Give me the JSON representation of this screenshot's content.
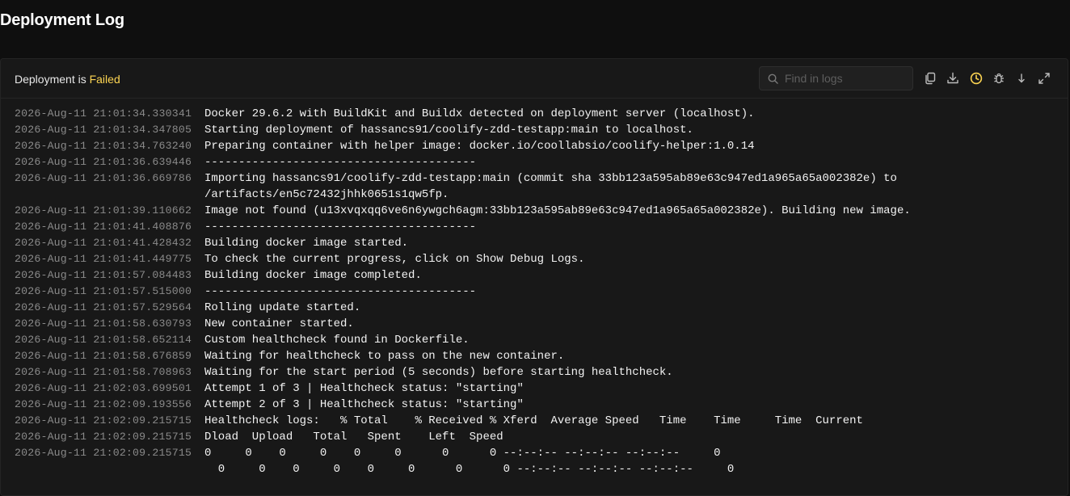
{
  "page": {
    "title": "Deployment Log"
  },
  "header": {
    "status_prefix": "Deployment is",
    "status_value": "Failed",
    "search_placeholder": "Find in logs",
    "toolbar": [
      {
        "name": "copy-logs",
        "icon": "copy-icon"
      },
      {
        "name": "download-logs",
        "icon": "download-icon"
      },
      {
        "name": "toggle-timestamps",
        "icon": "clock-icon",
        "active": true
      },
      {
        "name": "toggle-debug-logs",
        "icon": "bug-icon"
      },
      {
        "name": "scroll-to-bottom",
        "icon": "arrow-down-icon"
      },
      {
        "name": "fullscreen",
        "icon": "expand-icon"
      }
    ]
  },
  "colors": {
    "accent_failed": "#fcd452",
    "active_icon": "#fcd452",
    "timestamp": "#8a8a8a",
    "message": "#f2f2f2"
  },
  "logs": [
    {
      "ts": "2026-Aug-11 21:01:34.330341",
      "msg": "Docker 29.6.2 with BuildKit and Buildx detected on deployment server (localhost)."
    },
    {
      "ts": "2026-Aug-11 21:01:34.347805",
      "msg": "Starting deployment of hassancs91/coolify-zdd-testapp:main to localhost."
    },
    {
      "ts": "2026-Aug-11 21:01:34.763240",
      "msg": "Preparing container with helper image: docker.io/coollabsio/coolify-helper:1.0.14"
    },
    {
      "ts": "2026-Aug-11 21:01:36.639446",
      "msg": "----------------------------------------"
    },
    {
      "ts": "2026-Aug-11 21:01:36.669786",
      "msg": "Importing hassancs91/coolify-zdd-testapp:main (commit sha 33bb123a595ab89e63c947ed1a965a65a002382e) to"
    },
    {
      "ts": "",
      "msg": "/artifacts/en5c72432jhhk0651s1qw5fp."
    },
    {
      "ts": "2026-Aug-11 21:01:39.110662",
      "msg": "Image not found (u13xvqxqq6ve6n6ywgch6agm:33bb123a595ab89e63c947ed1a965a65a002382e). Building new image."
    },
    {
      "ts": "2026-Aug-11 21:01:41.408876",
      "msg": "----------------------------------------"
    },
    {
      "ts": "2026-Aug-11 21:01:41.428432",
      "msg": "Building docker image started."
    },
    {
      "ts": "2026-Aug-11 21:01:41.449775",
      "msg": "To check the current progress, click on Show Debug Logs."
    },
    {
      "ts": "2026-Aug-11 21:01:57.084483",
      "msg": "Building docker image completed."
    },
    {
      "ts": "2026-Aug-11 21:01:57.515000",
      "msg": "----------------------------------------"
    },
    {
      "ts": "2026-Aug-11 21:01:57.529564",
      "msg": "Rolling update started."
    },
    {
      "ts": "2026-Aug-11 21:01:58.630793",
      "msg": "New container started."
    },
    {
      "ts": "2026-Aug-11 21:01:58.652114",
      "msg": "Custom healthcheck found in Dockerfile."
    },
    {
      "ts": "2026-Aug-11 21:01:58.676859",
      "msg": "Waiting for healthcheck to pass on the new container."
    },
    {
      "ts": "2026-Aug-11 21:01:58.708963",
      "msg": "Waiting for the start period (5 seconds) before starting healthcheck."
    },
    {
      "ts": "2026-Aug-11 21:02:03.699501",
      "msg": "Attempt 1 of 3 | Healthcheck status: \"starting\""
    },
    {
      "ts": "2026-Aug-11 21:02:09.193556",
      "msg": "Attempt 2 of 3 | Healthcheck status: \"starting\""
    },
    {
      "ts": "2026-Aug-11 21:02:09.215715",
      "msg": "Healthcheck logs:   % Total    % Received % Xferd  Average Speed   Time    Time     Time  Current"
    },
    {
      "ts": "2026-Aug-11 21:02:09.215715",
      "msg": "Dload  Upload   Total   Spent    Left  Speed"
    },
    {
      "ts": "2026-Aug-11 21:02:09.215715",
      "msg": "0     0    0     0    0     0      0      0 --:--:-- --:--:-- --:--:--     0"
    },
    {
      "ts": "",
      "msg": "  0     0    0     0    0     0      0      0 --:--:-- --:--:-- --:--:--     0"
    }
  ]
}
